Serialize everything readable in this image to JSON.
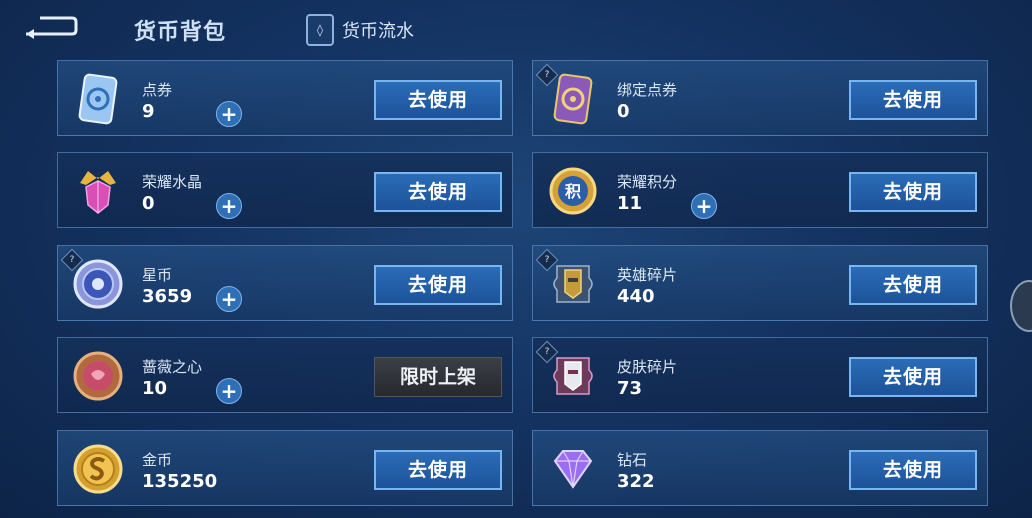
{
  "header": {
    "title": "货币背包",
    "flow_label": "货币流水",
    "flow_icon_glyph": "◊"
  },
  "buttons": {
    "use_label": "去使用",
    "limited_label": "限时上架",
    "plus_label": "+",
    "help_label": "?"
  },
  "currencies": [
    {
      "name": "点券",
      "amount": "9",
      "icon": "voucher-card-icon"
    },
    {
      "name": "绑定点券",
      "amount": "0",
      "icon": "bound-voucher-icon"
    },
    {
      "name": "荣耀水晶",
      "amount": "0",
      "icon": "glory-crystal-icon"
    },
    {
      "name": "荣耀积分",
      "amount": "11",
      "icon": "glory-points-icon"
    },
    {
      "name": "星币",
      "amount": "3659",
      "icon": "star-coin-icon"
    },
    {
      "name": "英雄碎片",
      "amount": "440",
      "icon": "hero-fragment-icon"
    },
    {
      "name": "蔷薇之心",
      "amount": "10",
      "icon": "rose-heart-icon"
    },
    {
      "name": "皮肤碎片",
      "amount": "73",
      "icon": "skin-fragment-icon"
    },
    {
      "name": "金币",
      "amount": "135250",
      "icon": "gold-coin-icon"
    },
    {
      "name": "钻石",
      "amount": "322",
      "icon": "diamond-icon"
    }
  ],
  "icon_glyphs": {
    "glory_points": "积"
  },
  "colors": {
    "accent": "#2b6cb8",
    "border": "#77b6f0",
    "background": "#143362"
  }
}
